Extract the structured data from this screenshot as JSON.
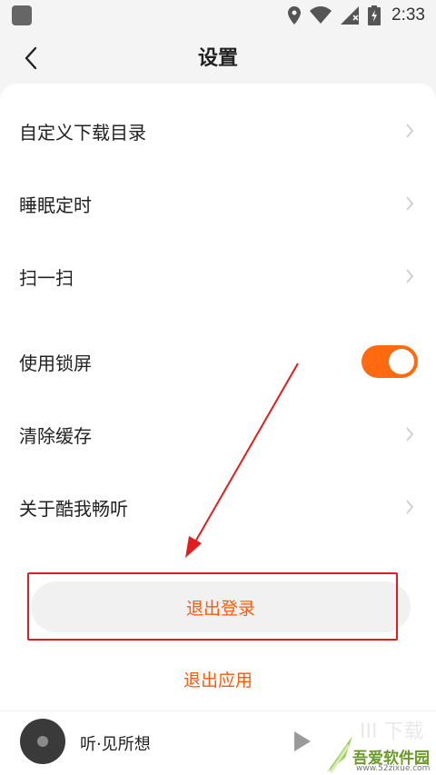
{
  "status_bar": {
    "time": "2:33",
    "icons": [
      "location-icon",
      "wifi-icon",
      "signal-icon",
      "battery-charging-icon"
    ]
  },
  "header": {
    "title": "设置",
    "back_icon": "chevron-left-icon"
  },
  "settings": {
    "items": [
      {
        "label": "自定义下载目录",
        "control": "chevron"
      },
      {
        "label": "睡眠定时",
        "control": "chevron"
      },
      {
        "label": "扫一扫",
        "control": "chevron"
      },
      {
        "label": "使用锁屏",
        "control": "toggle",
        "enabled": true
      },
      {
        "label": "清除缓存",
        "control": "chevron"
      },
      {
        "label": "关于酷我畅听",
        "control": "chevron"
      }
    ]
  },
  "actions": {
    "logout_label": "退出登录",
    "exit_app_label": "退出应用"
  },
  "player": {
    "track_title": "听·见所想"
  },
  "watermark": {
    "text": "吾爱软件园",
    "url": "www.52zixue.com"
  },
  "colors": {
    "accent": "#ff6a10",
    "annotation": "#e21d1d"
  }
}
